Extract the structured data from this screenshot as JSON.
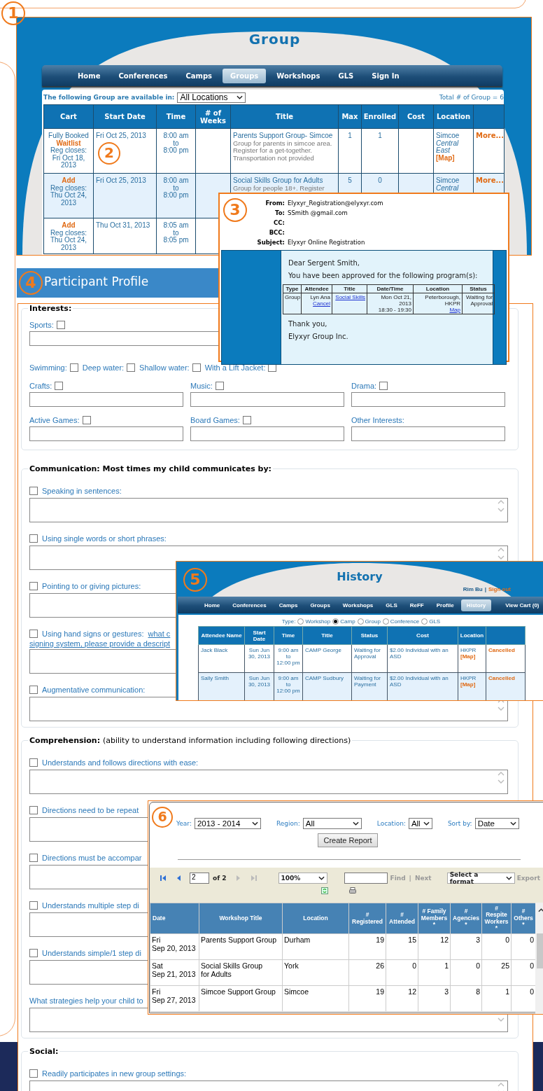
{
  "marker": "1",
  "group_page": {
    "title": "Group",
    "nav": [
      {
        "label": "Home",
        "selected": false
      },
      {
        "label": "Conferences",
        "selected": false
      },
      {
        "label": "Camps",
        "selected": false
      },
      {
        "label": "Groups",
        "selected": true
      },
      {
        "label": "Workshops",
        "selected": false
      },
      {
        "label": "GLS",
        "selected": false
      },
      {
        "label": "Sign In",
        "selected": false
      }
    ],
    "filter_label": "The following Group are available in:",
    "location_filter": "All Locations",
    "total": "Total # of Group = 6",
    "columns": [
      "Cart",
      "Start Date",
      "Time",
      "# of\nWeeks",
      "Title",
      "Max",
      "Enrolled",
      "Cost",
      "Location"
    ],
    "table_marker": "2",
    "rows": [
      {
        "cart": [
          {
            "text": "Fully Booked",
            "kind": "status"
          },
          {
            "text": "Waitlist",
            "kind": "action"
          },
          {
            "text": "Reg closes:\nFri Oct 18,\n2013",
            "kind": "status"
          }
        ],
        "start_date": "Fri Oct 25, 2013",
        "time": "8:00 am\nto\n8:00 pm",
        "title": "Parents Support Group- Simcoe",
        "description": "Group for parents in simcoe area. Register for a get-together. Transportation not provided",
        "max": "1",
        "enrolled": "1",
        "location": "Simcoe",
        "region": "Central\nEast",
        "map": "[Map]",
        "more": "More..."
      },
      {
        "cart": [
          {
            "text": "Add",
            "kind": "action"
          },
          {
            "text": "Reg closes:\nThu Oct 24,\n2013",
            "kind": "status"
          }
        ],
        "start_date": "Fri Oct 25, 2013",
        "time": "8:00 am\nto\n8:00 pm",
        "title": "Social Skills Group for Adults",
        "description": "Group for people 18+. Register",
        "max": "5",
        "enrolled": "0",
        "location": "Simcoe",
        "region": "Central",
        "more": "More..."
      },
      {
        "cart": [
          {
            "text": "Add",
            "kind": "action"
          },
          {
            "text": "Reg closes:\nThu Oct 24,\n2013",
            "kind": "status"
          }
        ],
        "start_date": "Thu Oct 31, 2013",
        "time": "8:05 am\nto\n8:05 pm"
      }
    ]
  },
  "email": {
    "marker": "3",
    "headers": [
      {
        "label": "From:",
        "value": "Elyxyr_Registration@elyxyr.com"
      },
      {
        "label": "To:",
        "value": "SSmith @gmail.com"
      },
      {
        "label": "CC:"
      },
      {
        "label": "BCC:"
      },
      {
        "label": "Subject:",
        "value": "Elyxyr Online Registration"
      }
    ],
    "greeting": "Dear Sergent Smith,",
    "intro": "You have been approved for the following program(s):",
    "columns": [
      "Type",
      "Attendee",
      "Title",
      "Date/Time",
      "Location",
      "Status"
    ],
    "rows": [
      {
        "type": "Group",
        "attendee": "Lyn Ana",
        "cancel": "Cancel",
        "title": "Social Skills",
        "date_time": "Mon Oct 21, 2013\n18:30 - 19:30",
        "location": "Peterborough, HKPR",
        "map": "Map",
        "status": "Waiting for\nApproval"
      }
    ],
    "closing": "Thank you,",
    "signature": "Elyxyr Group Inc."
  },
  "profile": {
    "marker": "4",
    "title": "Participant Profile",
    "interests": {
      "legend": "Interests:",
      "sports": {
        "label": "Sports:",
        "checked": false
      },
      "water": [
        {
          "label": "Swimming:",
          "checked": false
        },
        {
          "label": "Deep water:",
          "checked": false
        },
        {
          "label": "Shallow water:",
          "checked": false
        },
        {
          "label": "With a Lift Jacket:",
          "checked": false
        }
      ],
      "grid": [
        {
          "label": "Crafts:",
          "kind": "check",
          "checked": false
        },
        {
          "label": "Music:",
          "kind": "check",
          "checked": false
        },
        {
          "label": "Drama:",
          "kind": "check",
          "checked": false
        },
        {
          "label": "Active Games:",
          "kind": "check",
          "checked": false
        },
        {
          "label": "Board Games:",
          "kind": "check",
          "checked": false
        },
        {
          "label": "Other Interests:",
          "kind": "text"
        }
      ]
    },
    "sections": [
      {
        "legend": "Communication: Most times my child communicates by:",
        "items": [
          {
            "kind": "check",
            "label": "Speaking in sentences:",
            "checked": false
          },
          {
            "kind": "check",
            "label": "Using single words or short phrases:",
            "checked": false
          },
          {
            "kind": "check",
            "label": "Pointing to or giving pictures:",
            "checked": false
          },
          {
            "kind": "check",
            "label": "Using hand signs or gestures:",
            "link": "what c",
            "link_cont": "signing system, please provide a descript",
            "checked": false
          },
          {
            "kind": "check",
            "label": "Augmentative communication:",
            "checked": false
          }
        ]
      },
      {
        "legend": "Comprehension:",
        "note": "(ability to understand information including following directions)",
        "items": [
          {
            "kind": "check",
            "label": "Understands and follows directions with ease:",
            "checked": false
          },
          {
            "kind": "check",
            "label": "Directions need to be repeat",
            "checked": false
          },
          {
            "kind": "check",
            "label": "Directions must be accompar",
            "checked": false
          },
          {
            "kind": "check",
            "label": "Understands multiple step di",
            "checked": false
          },
          {
            "kind": "check",
            "label": "Understands simple/1 step di",
            "checked": false
          },
          {
            "kind": "question",
            "label": "What strategies help your child to"
          }
        ]
      },
      {
        "legend": "Social:",
        "items": [
          {
            "kind": "check",
            "label": "Readily participates in new group settings:",
            "checked": false
          }
        ]
      }
    ]
  },
  "history": {
    "marker": "5",
    "title": "History",
    "user": "Rim Bu",
    "separator": "|",
    "sign_out": "Sign out",
    "nav": [
      {
        "label": "Home",
        "selected": false
      },
      {
        "label": "Conferences",
        "selected": false
      },
      {
        "label": "Camps",
        "selected": false
      },
      {
        "label": "Groups",
        "selected": false
      },
      {
        "label": "Workshops",
        "selected": false
      },
      {
        "label": "GLS",
        "selected": false
      },
      {
        "label": "ReFF",
        "selected": false
      },
      {
        "label": "Profile",
        "selected": false
      },
      {
        "label": "History",
        "selected": true
      },
      {
        "label": "View Cart (0)",
        "selected": false
      }
    ],
    "type_label": "Type:",
    "types": [
      {
        "label": "Workshop",
        "selected": false
      },
      {
        "label": "Camp",
        "selected": true
      },
      {
        "label": "Group",
        "selected": false
      },
      {
        "label": "Conference",
        "selected": false
      },
      {
        "label": "GLS",
        "selected": false
      }
    ],
    "columns": [
      "Attendee Name",
      "Start\nDate",
      "Time",
      "Title",
      "Status",
      "Cost",
      "Location"
    ],
    "rows": [
      {
        "name": "Jack Black",
        "start": "Sun Jun\n30, 2013",
        "time": "9:00 am\nto\n12:00 pm",
        "title": "CAMP George",
        "status": "Waiting for\nApproval",
        "cost": "$2.00 Individual with an ASD",
        "location": "HKPR",
        "map": "[Map]",
        "action": "Cancelled"
      },
      {
        "name": "Sally Smith",
        "start": "Sun Jun\n30, 2013",
        "time": "9:00 am\nto\n12:00 pm",
        "title": "CAMP Sudbury",
        "status": "Waiting for\nPayment",
        "cost": "$2.00 Individual with an ASD",
        "location": "HKPR",
        "map": "[Map]",
        "action": "Cancelled"
      }
    ]
  },
  "report": {
    "marker": "6",
    "filters": [
      {
        "label": "Year:",
        "value": "2013 - 2014"
      },
      {
        "label": "Region:",
        "value": "All"
      },
      {
        "label": "Location:",
        "value": "All"
      },
      {
        "label": "Sort by:",
        "value": "Date"
      }
    ],
    "create_button": "Create Report",
    "page": "2",
    "page_of": "of 2",
    "zoom": "100%",
    "find": "Find",
    "find_separator": "|",
    "next": "Next",
    "format": "Select a format",
    "export": "Export",
    "columns": [
      "Date",
      "Workshop Title",
      "Location",
      "#\nRegistered",
      "#\nAttended",
      "# Family\nMembers\n*",
      "#\nAgencies\n*",
      "#\nRespite\nWorkers\n*",
      "#\nOthers\n*"
    ],
    "rows": [
      {
        "cells": [
          "Fri\nSep 20, 2013",
          "Parents Support Group",
          "Durham",
          "19",
          "15",
          "12",
          "3",
          "0",
          "0"
        ]
      },
      {
        "cells": [
          "Sat\nSep 21, 2013",
          "Social Skills Group\nfor Adults",
          "York",
          "26",
          "0",
          "1",
          "0",
          "25",
          "0"
        ]
      },
      {
        "cells": [
          "Fri\nSep 27, 2013",
          "Simcoe Support Group",
          "Simcoe",
          "19",
          "12",
          "3",
          "8",
          "1",
          "0"
        ]
      }
    ]
  }
}
